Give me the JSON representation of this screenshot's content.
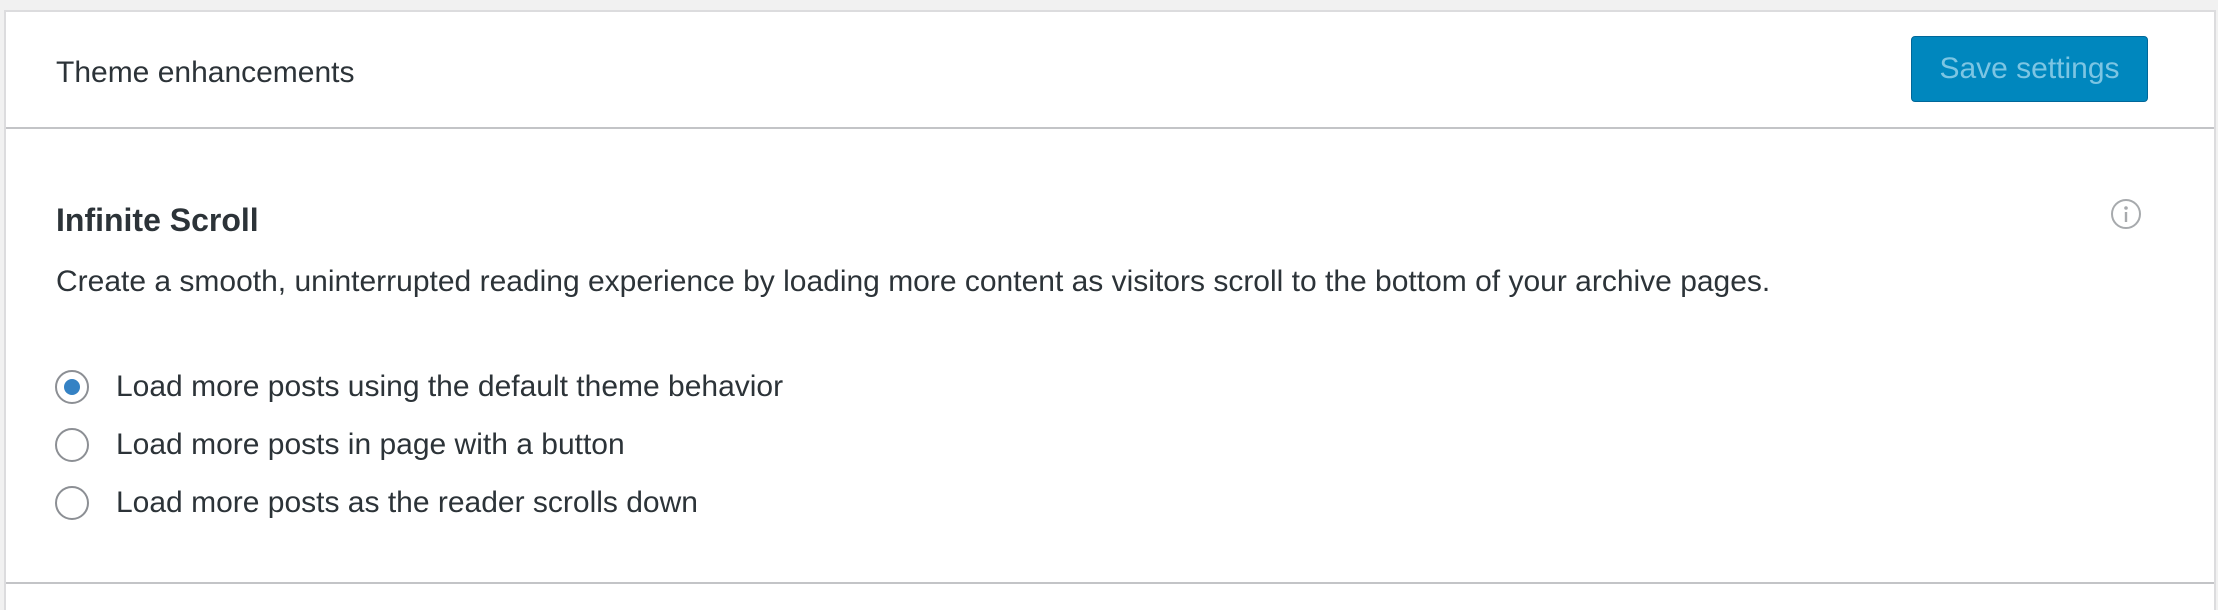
{
  "header": {
    "title": "Theme enhancements",
    "save_label": "Save settings"
  },
  "infinite_scroll": {
    "title": "Infinite Scroll",
    "description": "Create a smooth, uninterrupted reading experience by loading more content as visitors scroll to the bottom of your archive pages.",
    "info_icon": "info-circle-icon",
    "options": [
      {
        "label": "Load more posts using the default theme behavior",
        "selected": true
      },
      {
        "label": "Load more posts in page with a button",
        "selected": false
      },
      {
        "label": "Load more posts as the reader scrolls down",
        "selected": false
      }
    ]
  },
  "colors": {
    "accent": "#0087be",
    "radio_checked": "#3582c4",
    "border": "#c3c4c7"
  }
}
